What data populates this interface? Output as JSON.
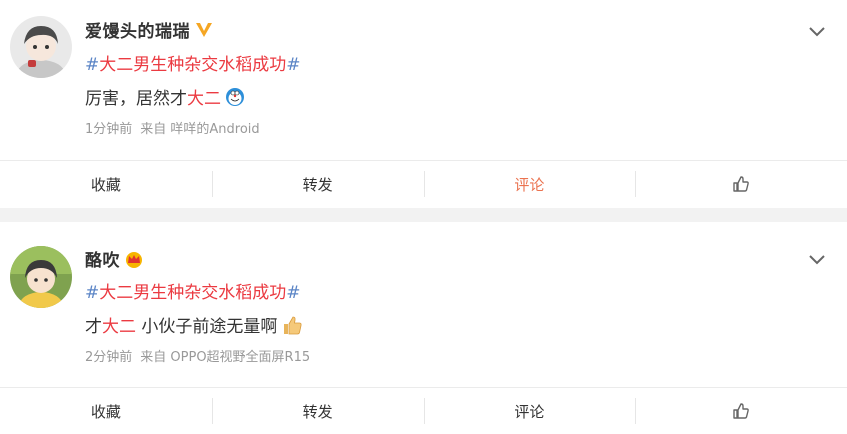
{
  "posts": [
    {
      "user": {
        "name": "爱馒头的瑞瑞",
        "badge_icon": "verified-v-icon"
      },
      "topic": {
        "hash_open": "#",
        "text": "大二男生种杂交水稻成功",
        "hash_close": "#"
      },
      "content": {
        "before": "厉害，居然才",
        "highlight": "大二",
        "after": "",
        "emoji": "doraemon-emoji"
      },
      "meta": {
        "time": "1分钟前",
        "source": "来自 咩咩的Android"
      },
      "actions": {
        "favorite": "收藏",
        "repost": "转发",
        "comment": "评论",
        "like_icon": "thumb-up-icon",
        "active": "comment"
      }
    },
    {
      "user": {
        "name": "酪吹",
        "badge_icon": "crown-icon"
      },
      "topic": {
        "hash_open": "#",
        "text": "大二男生种杂交水稻成功",
        "hash_close": "#"
      },
      "content": {
        "before": "才",
        "highlight": "大二",
        "after": " 小伙子前途无量啊",
        "emoji": "thumbs-up-emoji"
      },
      "meta": {
        "time": "2分钟前",
        "source": "来自 OPPO超视野全面屏R15"
      },
      "actions": {
        "favorite": "收藏",
        "repost": "转发",
        "comment": "评论",
        "like_icon": "thumb-up-icon",
        "active": ""
      }
    }
  ],
  "colors": {
    "topic": "#eb3a41",
    "hash": "#5b85c6",
    "active_action": "#eb7350",
    "meta": "#999999",
    "separator": "#f2f2f2"
  }
}
